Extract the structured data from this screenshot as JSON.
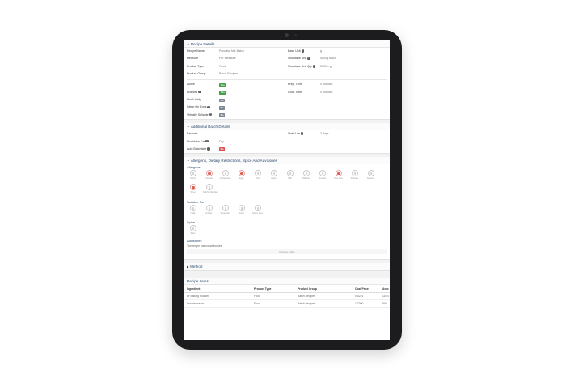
{
  "recipe_details": {
    "title": "Recipe Details",
    "left": [
      {
        "label": "Recipe Name",
        "value": "Pancake Mix Batch"
      },
      {
        "label": "Measure",
        "value": "Per Measure"
      },
      {
        "label": "Product Type",
        "value": "Food"
      },
      {
        "label": "Product Group",
        "value": "Batch Recipes"
      }
    ],
    "right": [
      {
        "label": "Base Unit",
        "value": "g"
      },
      {
        "label": "Stocktake Unit",
        "value": "5000g Batch"
      },
      {
        "label": "Stocktake Unit Qty",
        "value": "5000 x g"
      }
    ],
    "flags": [
      {
        "label": "Active",
        "badge": "Yes"
      },
      {
        "label": "Enabled",
        "badge": "Yes"
      },
      {
        "label": "Stock Only",
        "badge": "No"
      },
      {
        "label": "Setup On Epos",
        "badge": "No"
      },
      {
        "label": "Virtually Sellable",
        "badge": "No"
      }
    ],
    "times": [
      {
        "label": "Prep. Time",
        "value": "0 minutes"
      },
      {
        "label": "Cook Time",
        "value": "0 minutes"
      }
    ]
  },
  "batch_details": {
    "title": "Additional Batch Details",
    "barcode_label": "Barcode",
    "stocktake_cat_label": "Stocktake Cat",
    "stocktake_cat_value": "Dry",
    "auto_batchable_label": "Auto Batchable",
    "auto_batchable_badge": "No",
    "shelf_life_label": "Shelf Life",
    "shelf_life_value": "3 days"
  },
  "allergens_section": {
    "title": "Allergens, Dietary Restrictions, Spice And Advisories",
    "allergens_label": "Allergens",
    "allergens": [
      "Celery",
      "Cereals",
      "Crustaceans",
      "Eggs",
      "Fish",
      "Lupin",
      "Milk",
      "Molluscs",
      "Mustard",
      "Tree Nuts",
      "Peanuts",
      "Sesame",
      "Soya",
      "Sulphur Dioxide"
    ],
    "suitable_label": "Suitable For",
    "suitable": [
      "Halal",
      "Kosher",
      "Vegetarian",
      "Vegan",
      "Gluten Free"
    ],
    "spice_label": "Spice",
    "spice": [
      "Spicy"
    ],
    "advisories_label": "Advisories",
    "advisories_note": "The recipe has no advisories.",
    "pager": "Previous | Next"
  },
  "method": {
    "title": "Method"
  },
  "recipe_items": {
    "title": "Recipe Items",
    "columns": [
      "Ingredient",
      "Product Type",
      "Product Group",
      "Cost Price",
      "Amo"
    ],
    "rows": [
      [
        "Dr Baking Powder",
        "Food",
        "Batch Recipes",
        "0.0221",
        "110.0"
      ],
      [
        "Double cream",
        "Food",
        "Batch Recipes",
        "1.7300",
        "500"
      ]
    ]
  },
  "colors": {
    "accent": "#2c4a6e",
    "yes": "#43a047",
    "no_gray": "#7b8794",
    "no_red": "#d9534f",
    "device": "#1c1c1e"
  }
}
